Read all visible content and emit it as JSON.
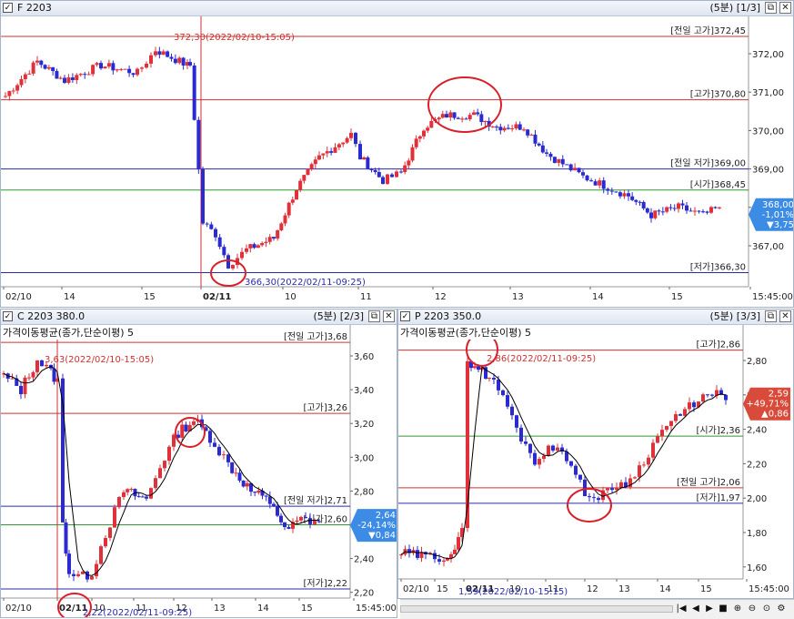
{
  "top": {
    "title": "F 2203",
    "interval": "(5분)",
    "page": "[1/3]",
    "y_labels": [
      "372,00",
      "371,00",
      "370,00",
      "369,00",
      "368,00",
      "367,00"
    ],
    "x_labels": [
      "02/10",
      "14",
      "15",
      "02/11",
      "10",
      "11",
      "12",
      "13",
      "14",
      "15",
      "15:45:00"
    ],
    "ref_lines": [
      {
        "label": "[전일 고가]372,45",
        "value": 372.45,
        "color": "#d03030"
      },
      {
        "label": "[고가]370,80",
        "value": 370.8,
        "color": "#d03030"
      },
      {
        "label": "[전일 저가]369,00",
        "value": 369.0,
        "color": "#2a2ab0"
      },
      {
        "label": "[시가]368,45",
        "value": 368.45,
        "color": "#2f9a2f"
      },
      {
        "label": "[저가]366,30",
        "value": 366.3,
        "color": "#2a2ab0"
      }
    ],
    "high_note": "372,30(2022/02/10-15:05)",
    "low_note": "366,30(2022/02/11-09:25)",
    "badge": {
      "price": "368,00",
      "pct": "-1,01%",
      "chg": "▼3,75",
      "color": "#3c8ce6"
    }
  },
  "bottom_left": {
    "title": "C 2203 380.0",
    "interval": "(5분)",
    "page": "[2/3]",
    "indicator": "가격이동평균(종가,단순이평) 5",
    "y_labels": [
      "3,60",
      "3,40",
      "3,20",
      "3,00",
      "2,80",
      "2,60",
      "2,40",
      "2,20"
    ],
    "x_labels": [
      "02/10",
      "02/11",
      "10",
      "11",
      "12",
      "13",
      "14",
      "15",
      "15:45:00"
    ],
    "ref_lines": [
      {
        "label": "[전일 고가]3,68",
        "value": 3.68,
        "color": "#d03030"
      },
      {
        "label": "[고가]3,26",
        "value": 3.26,
        "color": "#d03030"
      },
      {
        "label": "[전일 저가]2,71",
        "value": 2.71,
        "color": "#2a2ab0"
      },
      {
        "label": "[시가]2,60",
        "value": 2.6,
        "color": "#2f9a2f"
      },
      {
        "label": "[저가]2,22",
        "value": 2.22,
        "color": "#2a2ab0"
      }
    ],
    "high_note": "3,63(2022/02/10-15:05)",
    "low_note": "2,22(2022/02/11-09:25)",
    "badge": {
      "price": "2,64",
      "pct": "-24,14%",
      "chg": "▼0,84",
      "color": "#3c8ce6"
    }
  },
  "bottom_right": {
    "title": "P 2203 350.0",
    "interval": "(5분)",
    "page": "[3/3]",
    "indicator": "가격이동평균(종가,단순이평) 5",
    "y_labels": [
      "2,80",
      "2,60",
      "2,40",
      "2,20",
      "2,00",
      "1,80",
      "1,60"
    ],
    "x_labels": [
      "02/10",
      "15",
      "02/11",
      "10",
      "11",
      "12",
      "13",
      "14",
      "15",
      "15:45:00"
    ],
    "ref_lines": [
      {
        "label": "[고가]2,86",
        "value": 2.86,
        "color": "#d03030"
      },
      {
        "label": "[시가]2,36",
        "value": 2.36,
        "color": "#2f9a2f"
      },
      {
        "label": "[전일 고가]2,06",
        "value": 2.06,
        "color": "#d03030"
      },
      {
        "label": "[저가]1,97",
        "value": 1.97,
        "color": "#2a2ab0"
      }
    ],
    "high_note": "2,86(2022/02/11-09:25)",
    "low_note": "1,59(2022/02/10-15:15)",
    "badge": {
      "price": "2,59",
      "pct": "+49,71%",
      "chg": "▲0,86",
      "color": "#d84a3a"
    }
  },
  "colors": {
    "up": "#e0303a",
    "down": "#2a2ad0",
    "ma": "#000000",
    "circle": "#d8202a"
  },
  "icons": [
    "checkbox-icon",
    "restore-icon",
    "close-icon",
    "scroll-left-end-icon",
    "scroll-left-icon",
    "play-icon",
    "stop-icon",
    "zoom-in-icon",
    "zoom-out-icon",
    "search-icon",
    "settings-icon"
  ]
}
